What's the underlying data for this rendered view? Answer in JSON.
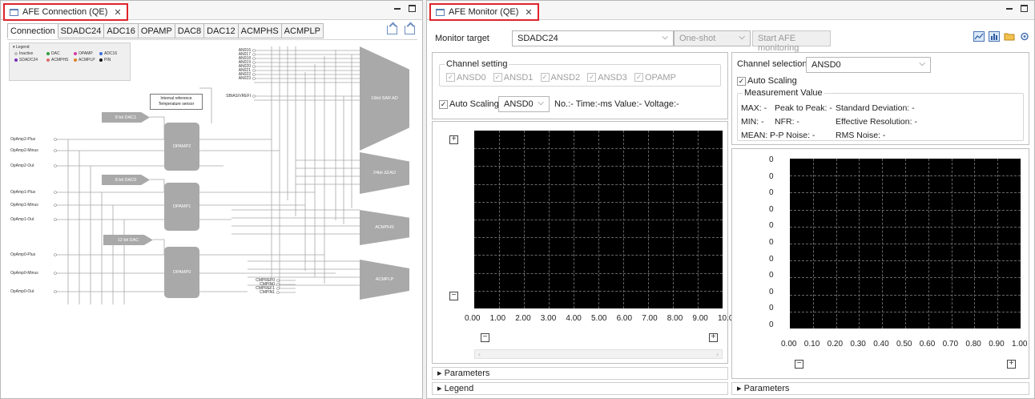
{
  "left_view": {
    "title": "AFE Connection (QE)",
    "close": "✕",
    "tabs": [
      "Connection",
      "SDADC24",
      "ADC16",
      "OPAMP",
      "DAC8",
      "DAC12",
      "ACMPHS",
      "ACMPLP"
    ],
    "legend": {
      "title": "▾ Legend",
      "items": [
        {
          "label": "Inactive",
          "color": "#bdbdbd"
        },
        {
          "label": "DAC",
          "color": "#2e9e3e"
        },
        {
          "label": "OPAMP",
          "color": "#d63aa8"
        },
        {
          "label": "ADC16",
          "color": "#3c6fd6"
        },
        {
          "label": "SDADC24",
          "color": "#7a2fb5"
        },
        {
          "label": "ACMPHS",
          "color": "#e06a6a"
        },
        {
          "label": "ACMPLP",
          "color": "#e08020"
        },
        {
          "label": "PIN",
          "color": "#111111"
        }
      ]
    },
    "internal_ref": "Internal reference Temperature sensor",
    "blocks": {
      "dac1": "8 bit DAC1",
      "dac0": "8 bit DAC0",
      "dac12": "12 bit DAC",
      "opamp2": "OPAMP2",
      "opamp1": "OPAMP1",
      "opamp0": "OPAMP0",
      "sar": "16bit SAR AD",
      "sd": "24bit ΔΣAD",
      "acmphs": "ACMPHS",
      "acmplp": "ACMPLP"
    },
    "an_pins": [
      "AN016",
      "AN017",
      "AN018",
      "AN019",
      "AN020",
      "AN021",
      "AN022",
      "AN023",
      "SBIAS/VREFI"
    ],
    "cmp_pins": [
      "CMPREF0",
      "CMPIN0",
      "CMPREF1",
      "CMPIN1"
    ],
    "opamp_pins": [
      "OpAmp2-Plus",
      "OpAmp2-Minus",
      "OpAmp2-Out",
      "OpAmp1-Plus",
      "OpAmp1-Minus",
      "OpAmp1-Out",
      "OpAmp0-Plus",
      "OpAmp0-Minus",
      "OpAmp0-Out"
    ]
  },
  "right_view": {
    "title": "AFE Monitor (QE)",
    "close": "✕",
    "monitor_target_label": "Monitor target",
    "monitor_target_value": "SDADC24",
    "mode_value": "One-shot",
    "start_button": "Start AFE monitoring",
    "channel_setting": {
      "legend": "Channel setting",
      "channels": [
        "ANSD0",
        "ANSD1",
        "ANSD2",
        "ANSD3",
        "OPAMP"
      ]
    },
    "auto_scaling": "Auto Scaling",
    "channel_combo": "ANSD0",
    "status": "No.:- Time:-ms Value:- Voltage:-",
    "time_plot": {
      "x_ticks": [
        "0.00",
        "1.00",
        "2.00",
        "3.00",
        "4.00",
        "5.00",
        "6.00",
        "7.00",
        "8.00",
        "9.00",
        "10.00"
      ]
    },
    "parameters": "Parameters",
    "legend": "Legend",
    "channel_selection_label": "Channel selection",
    "channel_selection_value": "ANSD0",
    "measurement": {
      "legend": "Measurement Value",
      "max": "MAX: -",
      "ptp": "Peak to Peak: -",
      "sd": "Standard Deviation: -",
      "min": "MIN: -",
      "nfr": "NFR: -",
      "eres": "Effective Resolution: -",
      "mean": "MEAN: -",
      "ppn": "P-P Noise: -",
      "rms": "RMS Noise: -"
    },
    "hist_plot": {
      "y_ticks": [
        "0",
        "0",
        "0",
        "0",
        "0",
        "0",
        "0",
        "0",
        "0",
        "0",
        "0"
      ],
      "x_ticks": [
        "0.00",
        "0.10",
        "0.20",
        "0.30",
        "0.40",
        "0.50",
        "0.60",
        "0.70",
        "0.80",
        "0.90",
        "1.00"
      ]
    }
  },
  "colors": {
    "highlight": "#e0242c",
    "block": "#a9a9a9",
    "plot_bg": "#000000"
  }
}
